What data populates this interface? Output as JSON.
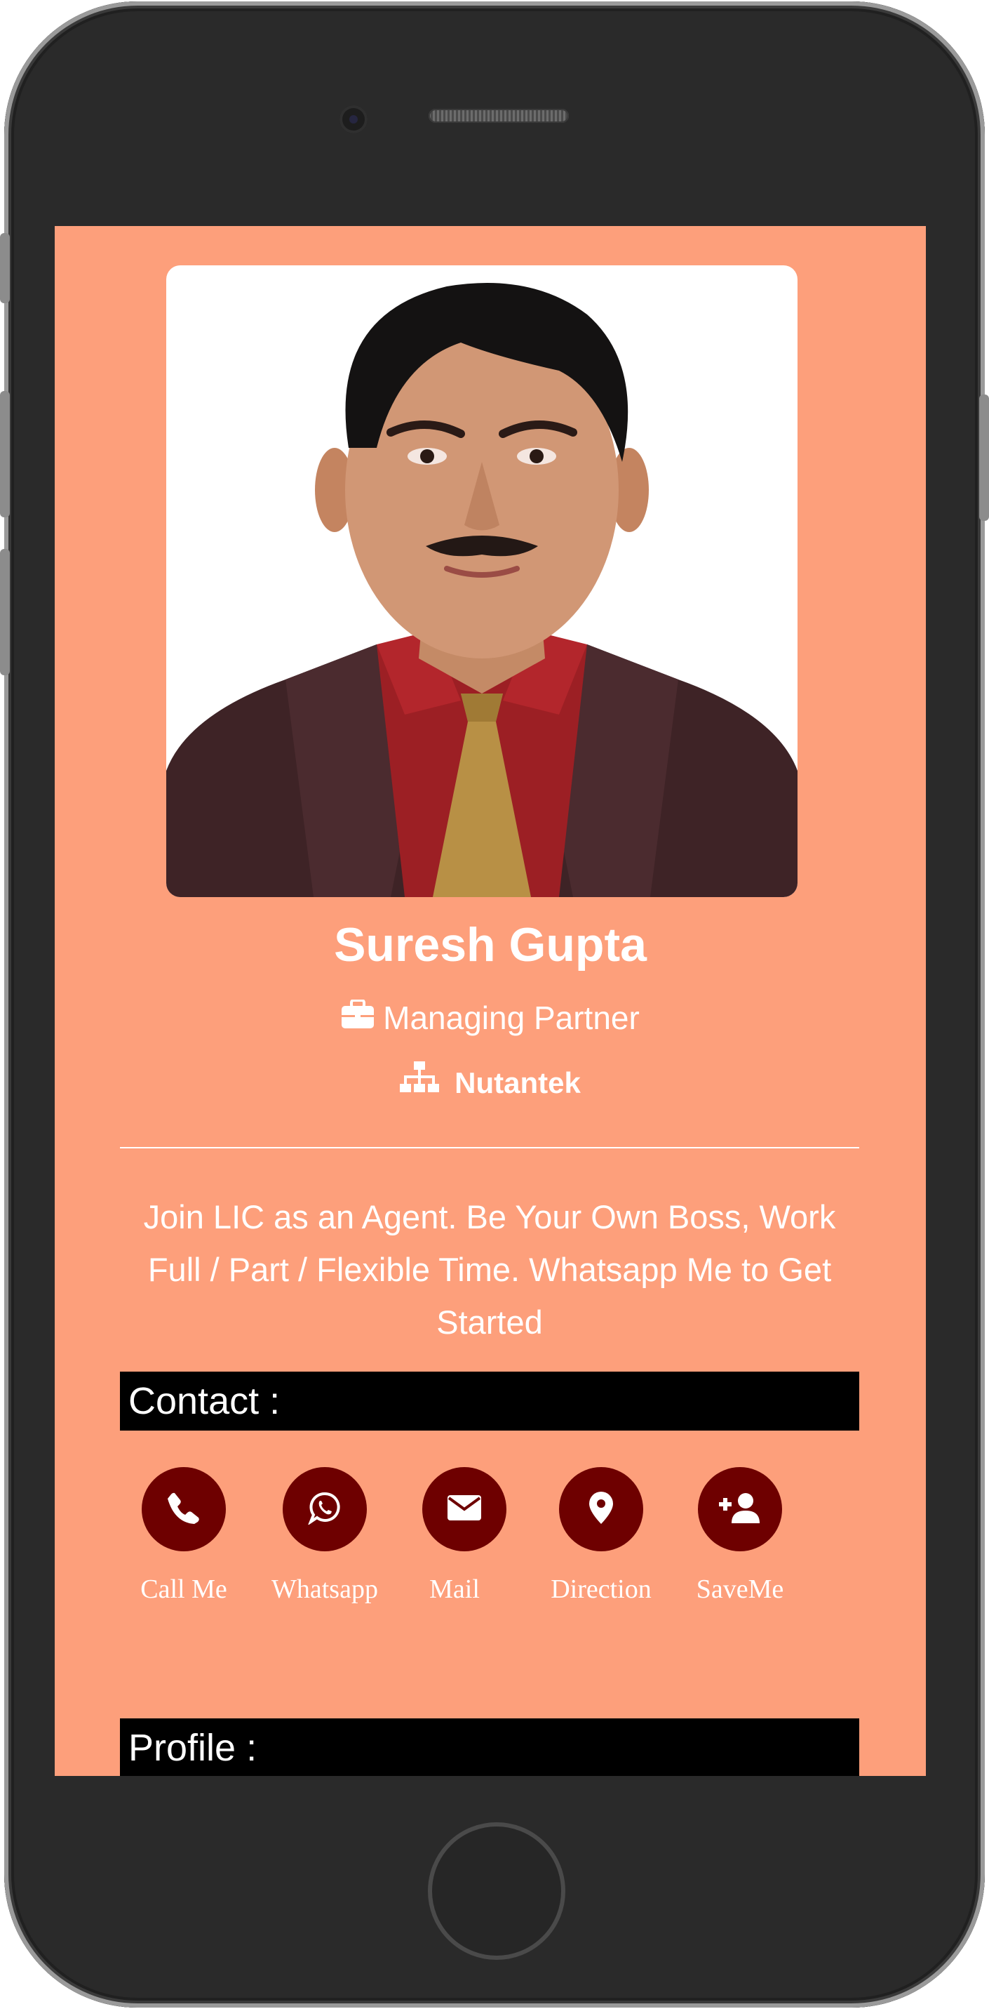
{
  "profile": {
    "name": "Suresh Gupta",
    "title": "Managing Partner",
    "company": "Nutantek",
    "bio": "Join LIC as an Agent. Be Your Own Boss, Work Full / Part / Flexible Time. Whatsapp Me to Get Started"
  },
  "sections": {
    "contact": "Contact :",
    "profile": "Profile :"
  },
  "actions": [
    {
      "label": "Call Me",
      "icon": "phone-icon"
    },
    {
      "label": "Whatsapp",
      "icon": "whatsapp-icon"
    },
    {
      "label": "Mail",
      "icon": "envelope-icon"
    },
    {
      "label": "Direction",
      "icon": "map-marker-icon"
    },
    {
      "label": "SaveMe",
      "icon": "user-plus-icon"
    }
  ],
  "colors": {
    "background": "#fd9f7b",
    "button": "#6e0000",
    "section_bar": "#000000",
    "text": "#ffffff"
  }
}
